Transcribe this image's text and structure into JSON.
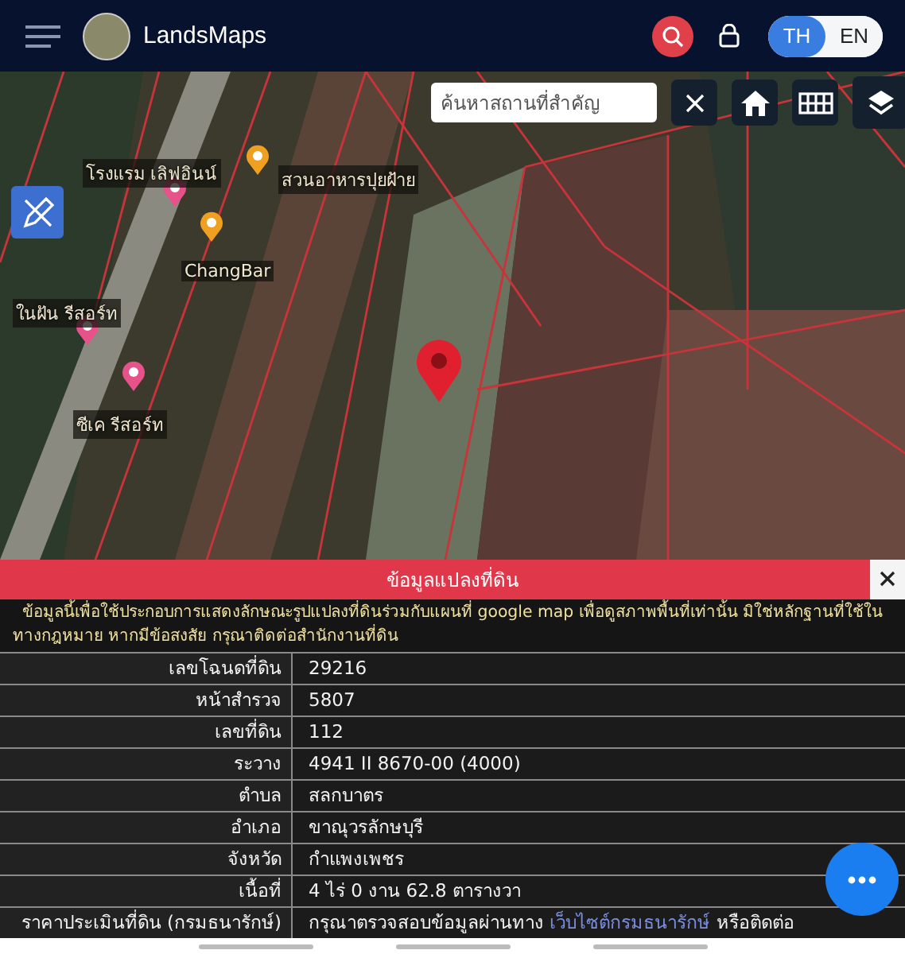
{
  "header": {
    "title": "LandsMaps",
    "languages": [
      {
        "label": "TH",
        "selected": true
      },
      {
        "label": "EN",
        "selected": false
      }
    ]
  },
  "map": {
    "search": {
      "placeholder": "ค้นหาสถานที่สำคัญ"
    },
    "places": [
      {
        "name": "โรงแรม เลิฟอินน์",
        "kind": "hotel"
      },
      {
        "name": "สวนอาหารปุยฝ้าย",
        "kind": "restaurant"
      },
      {
        "name": "ChangBar",
        "kind": "bar"
      },
      {
        "name": "ในฝัน รีสอร์ท",
        "kind": "hotel"
      },
      {
        "name": "ซีเค รีสอร์ท",
        "kind": "hotel"
      }
    ]
  },
  "panel": {
    "title": "ข้อมูลแปลงที่ดิน",
    "notice": [
      "ข้อมูลนี้เพื่อใช้ประกอบการแสดงลักษณะรูปแปลงที่ดินร่วมกับแผนที่ google map เพื่อดูสภาพพื้นที่เท่านั้น มิใช่หลักฐานที่ใช้ใน",
      "ทางกฎหมาย หากมีข้อสงสัย กรุณาติดต่อสำนักงานที่ดิน"
    ],
    "rows": [
      {
        "label": "เลขโฉนดที่ดิน",
        "value": "29216"
      },
      {
        "label": "หน้าสำรวจ",
        "value": "5807"
      },
      {
        "label": "เลขที่ดิน",
        "value": "112"
      },
      {
        "label": "ระวาง",
        "value": "4941 II 8670-00 (4000)"
      },
      {
        "label": "ตำบล",
        "value": "สลกบาตร"
      },
      {
        "label": "อำเภอ",
        "value": "ขาณุวรลักษบุรี"
      },
      {
        "label": "จังหวัด",
        "value": "กำแพงเพชร"
      },
      {
        "label": "เนื้อที่",
        "value": "4 ไร่ 0 งาน 62.8 ตารางวา"
      },
      {
        "label": "ราคาประเมินที่ดิน (กรมธนารักษ์)",
        "value": "กรุณาตรวจสอบข้อมูลผ่านทาง",
        "link": "เว็บไซต์กรมธนารักษ์",
        "value_after": "หรือติดต่อ"
      }
    ]
  }
}
